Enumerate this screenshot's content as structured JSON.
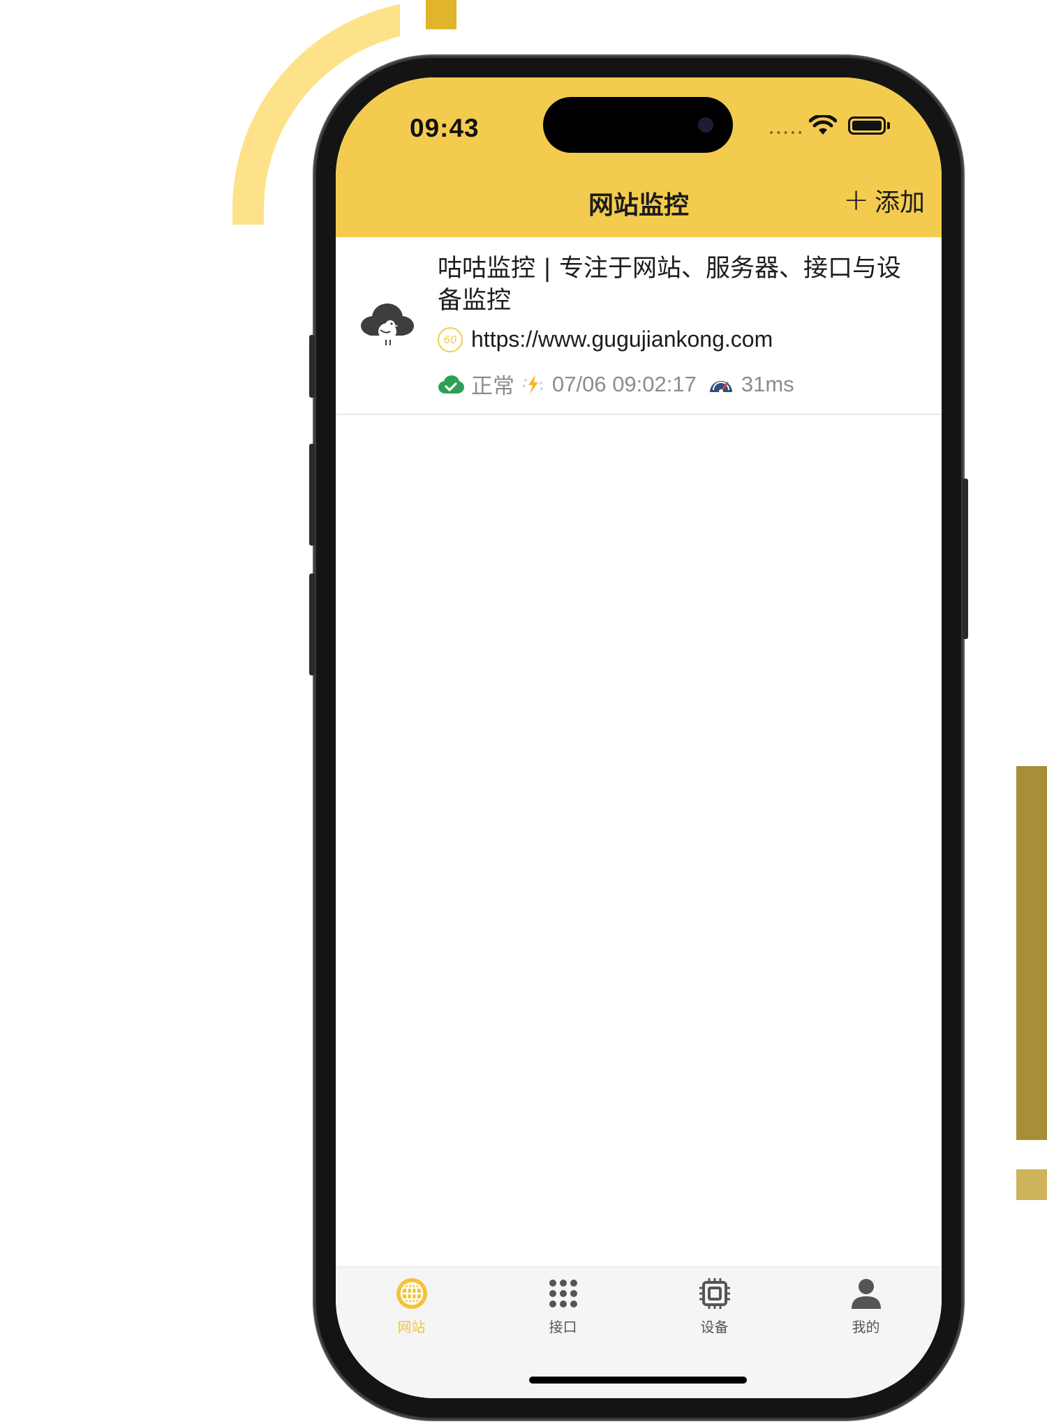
{
  "status_bar": {
    "time": "09:43",
    "signal_dots": "•••••"
  },
  "header": {
    "title": "网站监控",
    "add_label": "添加",
    "bg_color": "#f3cc4f"
  },
  "monitors": [
    {
      "title": "咕咕监控 | 专注于网站、服务器、接口与设备监控",
      "interval": "60",
      "url": "https://www.gugujiankong.com",
      "status": "正常",
      "status_color": "#2ea056",
      "last_check": "07/06 09:02:17",
      "response_time": "31ms",
      "icons": [
        "cloud-bird-logo",
        "interval-icon",
        "cloud-check-icon",
        "lightning-icon",
        "speedometer-icon"
      ]
    }
  ],
  "tabbar": {
    "tabs": [
      {
        "label": "网站",
        "icon": "globe-icon",
        "active": true
      },
      {
        "label": "接口",
        "icon": "grid-dots-icon",
        "active": false
      },
      {
        "label": "设备",
        "icon": "chip-icon",
        "active": false
      },
      {
        "label": "我的",
        "icon": "person-icon",
        "active": false
      }
    ],
    "active_color": "#f3c33a"
  }
}
